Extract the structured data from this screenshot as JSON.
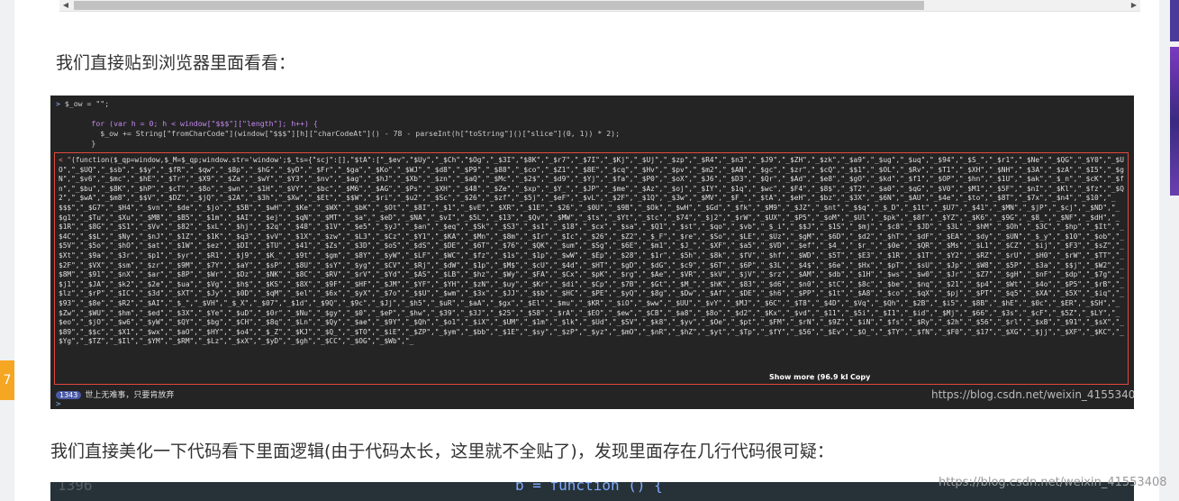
{
  "side": {
    "left_badge": "7"
  },
  "paragraphs": {
    "intro": "我们直接贴到浏览器里面看看：",
    "followup": "我们直接美化一下代码看下里面逻辑(由于代码太长，这里就不全贴了)，发现里面存在几行代码很可疑："
  },
  "console": {
    "line1_prompt": ">",
    "line1_code": " $_ow = \"\";",
    "line2": "        for (var h = 0; h < window[\"$$$\"][\"length\"]; h++) {",
    "line3": "          $_ow += String[\"fromCharCode\"](window[\"$$$\"][h][\"charCodeAt\"]() - 78 - parseInt(h[\"toString\"]()[\"slice\"](0, 1)) * 2);",
    "line4": "        }",
    "output_prefix": "< \"",
    "output_text": "(function($_qp=window,$_M=$_qp;window.str='window';$_ts={\"scj\":[],\"$tA\":[\"_$ev\",\"$Uy\",\"_$Ch\",\"$Og\",\"_$3I\",\"$8K\",\"_$r7\",\"_$7I\",\"_$Kj\",\"_$Uj\",\"_$zp\",\"_$R4\",\"_$n3\",\"_$J9\",\"_$ZH\",\"_$zk\",\"_$a9\",\"_$ug\",\"_$uq\",\"_$94\",\"_$S_\",\"_$r1\",\"_$Ne\",\"_$QG\",\"_$Y0\",\"_$UO\",\"_$UQ\",\"_$sb\",\"_$$y\",\"_$fR\",\"_$qw\",\"_$8p\",\"_$hG\",\"_$yD\",\"_$Fr\",\"_$ga\",\"_$Ko\",\"_$WJ\",\"_$d8\",\"_$P9\",\"_$88\",\"_$co\",\"_$Z1\",\"_$8E\",\"_$cq\",\"_$Hv\",\"_$pv\",\"_$m2\",\"_$AN\",\"_$gc\",\"_$zr\",\"_$cQ\",\"_$$1\",\"_$OL\",\"_$Rv\",\"_$T1\",\"_$XH\",\"_$NH\",\"_$3A\",\"_$zA\",\"_$I5\",\"_$gN\",\"_$v6\",\"_$mc\",\"_$hE\",\"_$Tr\",\"_$X9\",\"_$Za\",\"_$wY\",\"_$Y3\",\"_$nv\",\"_$ag\",\"_$hJ\",\"_$Xb\",\"_$zn\",\"_$aQ\",\"_$Mc\",\"_$2$\",\"_$d9\",\"_$Yj\",\"_$fa\",\"_$P0\",\"_$oX\",\"_$J6\",\"_$D3\",\"_$Qr\",\"_$Ad\",\"_$e8\",\"_$gO\",\"_$kd\",\"_$f1\",\"_$OP\",\"_$hn\",\"_$1U\",\"_$ak\",\"_$_n\",\"_$cK\",\"_$fn\",\"_$bu\",\"_$8K\",\"_$hP\",\"_$cT\",\"_$8o\",\"_$wn\",\"_$1H\",\"_$VY\",\"_$bc\",\"_$M6\",\"_$AG\",\"_$Ps\",\"_$XH\",\"_$48\",\"_$Ze\",\"_$xp\",\"_$Y_\",\"_$JP\",\"_$me\",\"_$Az\",\"_$oj\",\"_$IY\",\"_$1q\",\"_$wc\",\"_$F4\",\"_$8$\",\"_$T2\",\"_$a0\",\"_$qG\",\"_$V0\",\"_$M1\",\"_$5F\",\"_$nI\",\"_$Kl\",\"_$fz\",\"_$Q2\",\"_$wA\",\"_$m8\",\"_$$V\",\"_$DZ\",\"_$jQ\",\"_$2A\",\"_$3h\",\"_$Xw\",\"_$Et\",\"_$$W\",\"_$ri\",\"_$u2\",\"_$Sc\",\"_$26\",\"_$zf\",\"_$5j\",\"_$eF\",\"_$vL\",\"_$2F\",\"_$1Q\",\"_$3w\",\"_$MV\",\"_$F_\",\"_$tA\",\"_$eH\",\"_$bz\",\"_$3X\",\"_$6N\",\"_$AU\",\"_$4e\",\"_$to\",\"_$8T\",\"_$7x\",\"_$n4\",\"_$10\",\"_$$$\",\"_$G7\",\"_$H4\",\"_$vn\",\"_$de\",\"_$jo\",\"_$5B\",\"_$wH\",\"_$Ke\",\"_$WX\",\"_$bK\",\"_$Ot\",\"_$8I\",\"_$1\",\"_$vE\",\"_$XR\",\"_$1E\",\"_$26\",\"_$0U\",\"_$9B\",\"_$Ok\",\"_$wH\",\"_$Gd\",\"_$fk\",\"_$M9\",\"_$JZ\",\"_$nt\",\"_$$q\",\"_$_D\",\"_$1t\",\"_$U7\",\"_$41\",\"_$MN\",\"_$jP\",\"_$cj\",\"_$ND\",\"_$g1\",\"_$Tu\",\"_$Xu\",\"_$MB\",\"_$B5\",\"_$1m\",\"_$AI\",\"_$ej\",\"_$qN\",\"_$MT\",\"_$a\",\"_$eD\",\"_$NA\",\"_$vI\",\"_$5L\",\"_$13\",\"_$Qv\",\"_$MW\",\"_$ts\",\"_$Yt\",\"_$tc\",\"_$74\",\"_$j2\",\"_$rW\",\"_$UX\",\"_$P5\",\"_$oM\",\"_$Ul\",\"_$pk\",\"_$8f\",\"_$YZ\",\"_$K6\",\"_$9G\",\"_$8_\",\"_$NF\",\"_$dH\",\"_$1R\",\"_$8G\",\"_$S1\",\"_$Vv\",\"_$82\",\"_$xL\",\"_$hj\",\"_$2q\",\"_$48\",\"_$1V\",\"_$e5\",\"_$yJ\",\"_$an\",\"_$eq\",\"_$Sk\",\"_$S3\",\"_$s1\",\"_$18\",\"_$cx\",\"_$sa\",\"_$Q1\",\"_$st\",\"_$qo\",\"_$vb\",\"_$_i\",\"_$$J\",\"_$1S\",\"_$mj\",\"_$c8\",\"_$JD\",\"_$3L\",\"_$hM\",\"_$Oh\",\"_$3C\",\"_$hp\",\"_$It\",\"_$4C\",\"_$$L\",\"_$Ny\",\"_$nJ\",\"_$1Z\",\"_$1K\",\"_$q3\",\"_$vV\",\"_$1X\",\"_$zw\",\"_$L3\",\"_$Cz\",\"_$Y1\",\"_$KA\",\"_$Mn\",\"_$8m\",\"_$Ir\",\"_$Ic\",\"_$26\",\"_$Z2\",\"_$_F\",\"_$re\",\"_$So\",\"_$LE\",\"_$Uz\",\"_$gM\",\"_$6D\",\"_$d2\",\"_$hT\",\"_$dF\",\"_$EA\",\"_$dy\",\"_$UN\",\"_$_y\",\"_$10\",\"_$ob\",\"_$5V\",\"_$5o\",\"_$hO\",\"_$at\",\"_$1W\",\"_$ez\",\"_$DI\",\"_$TU\",\"_$41\",\"_$Zs\",\"_$3D\",\"_$oS\",\"_$dS\",\"_$DE\",\"_$6T\",\"_$76\",\"_$QK\",\"_$um\",\"_$Sg\",\"_$6E\",\"_$m1\",\"_$J_\",\"_$XF\",\"_$a5\",\"_$VD\",\"_$ef\",\"_$4_\",\"_$r_\",\"_$0e\",\"_$QR\",\"_$Ms\",\"_$L1\",\"_$CZ\",\"_$ij\",\"_$F3\",\"_$sZ\",\"_$Xt\",\"_$9a\",\"_$3r\",\"_$p1\",\"_$yr\",\"_$R1\",\"_$j9\",\"_$K_\",\"_$9t\",\"_$gm\",\"_$8Y\",\"_$yW\",\"_$LF\",\"_$WC\",\"_$fz\",\"_$1s\",\"_$1p\",\"_$wW\",\"_$Ep\",\"_$28\",\"_$1r\",\"_$5h\",\"_$8k\",\"_$fV\",\"_$hf\",\"_$WD\",\"_$5T\",\"_$E3\",\"_$1R\",\"_$1T\",\"_$Y2\",\"_$RZ\",\"_$rU\",\"_$H0\",\"_$rW\",\"_$TT\",\"_$2F\",\"_$VX\",\"_$sm\",\"_$zr\",\"_$9M\",\"_$7Y\",\"_$aY\",\"_$sP\",\"_$8U\",\"_$sY\",\"_$yg\",\"_$CV\",\"_$Rj\",\"_$dW\",\"_$1p\",\"_$M$\",\"_$cU\",\"_$4d\",\"_$HT\",\"_$gD\",\"_$dG\",\"_$c9\",\"_$6T\",\"_$6P\",\"_$3L\",\"_$4$\",\"_$6e\",\"_$Hx\",\"_$pT\",\"_$sU\",\"_$Jp\",\"_$W8\",\"_$5P\",\"_$3a\",\"_$$j\",\"_$W2\",\"_$8M\",\"_$91\",\"_$nX\",\"_$ar\",\"_$8P\",\"_$Wr\",\"_$Dz\",\"_$NK\",\"_$8C\",\"_$RV\",\"_$rV\",\"_$Yd\",\"_$AS\",\"_$LB\",\"_$hz\",\"_$Wy\",\"_$FA\",\"_$Cx\",\"_$pK\",\"_$rg\",\"_$Ae\",\"_$VR\",\"_$kV\",\"_$jV\",\"_$rz\",\"_$AM\",\"_$db\",\"_$1H\",\"_$ws\",\"_$w0\",\"_$Jr\",\"_$Z7\",\"_$gH\",\"_$nF\",\"_$dp\",\"_$7g\",\"_$j1\",\"_$JA\",\"_$k2\",\"_$2e\",\"_$ua\",\"_$Vg\",\"_$h$\",\"_$KS\",\"_$8X\",\"_$9F\",\"_$HF\",\"_$JM\",\"_$YF\",\"_$YH\",\"_$zN\",\"_$uy\",\"_$Kr\",\"_$di\",\"_$Cp\",\"_$7B\",\"_$Gt\",\"_$M_\",\"_$hK\",\"_$83\",\"_$d6\",\"_$n0\",\"_$tC\",\"_$8c\",\"_$be\",\"_$nq\",\"_$21\",\"_$p4\",\"_$Wt\",\"_$4o\",\"_$P5\",\"_$rB\",\"_$lz\",\"_$rP\",\"_$IC\",\"_$3d\",\"_$XT\",\"_$Jy\",\"_$0D\",\"_$qM\",\"_$el\",\"_$6x\",\"_$yX\",\"_$7o\",\"_$$U\",\"_$wm\",\"_$3x\",\"_$JJ\",\"_$$b\",\"_$HC\",\"_$PE\",\"_$yQ\",\"_$8g\",\"_$Dw\",\"_$Af\",\"_$DE\",\"_$h6\",\"_$PP\",\"_$1t\",\"_$A8\",\"_$co\",\"_$qX\",\"_$pj\",\"_$PT\",\"_$q5\",\"_$XA\",\"_$5X\",\"_$iq\",\"_$93\",\"_$8e\",\"_$R2\",\"_$AI\",\"_$_\",\"_$VH\",\"_$_X\",\"_$07\",\"_$1d\",\"_$9Q\",\"_$9c\",\"_$Jj\",\"_$h5\",\"_$uR\",\"_$aA\",\"_$gx\",\"_$El\",\"_$mu\",\"_$KR\",\"_$iO\",\"_$ww\",\"_$UU\",\"_$vY\",\"_$MJ\",\"_$6C\",\"_$T8\",\"_$4D\",\"_$Vq\",\"_$Qh\",\"_$2B\",\"_$i5\",\"_$8B\",\"_$hE\",\"_$0c\",\"_$ER\",\"_$SH\",\"_$Zw\",\"_$WU\",\"_$hm\",\"_$ed\",\"_$3X\",\"_$Ye\",\"_$uD\",\"_$0r\",\"_$Nu\",\"_$gy\",\"_$0\",\"_$eP\",\"_$hw\",\"_$39\",\"_$3J\",\"_$25\",\"_$58\",\"_$rA\",\"_$EO\",\"_$ew\",\"_$CB\",\"_$a8\",\"_$8o\",\"_$d2\",\"_$Kx\",\"_$vd\",\"_$11\",\"_$5i\",\"_$I1\",\"_$id\",\"_$Mj\",\"_$66\",\"_$3s\",\"_$cF\",\"_$5Z\",\"_$LY\",\"_$eo\",\"_$jO\",\"_$w6\",\"_$yW\",\"_$QY\",\"_$bg\",\"_$CH\",\"_$8q\",\"_$Ln\",\"_$Qy\",\"_$ae\",\"_$9Y\",\"_$Qh\",\"_$o1\",\"_$iX\",\"_$UM\",\"_$1m\",\"_$lk\",\"_$Ud\",\"_$SV\",\"_$k8\",\"_$yv\",\"_$Oe\",\"_$pt\",\"_$FM\",\"_$rN\",\"_$9Z\",\"_$iN\",\"_$fs\",\"_$Ry\",\"_$2h\",\"_$56\",\"_$rl\",\"_$xB\",\"_$91\",\"_$sX\",\"_$89\",\"_$$c\",\"_$X1\",\"_$wx\",\"_$aO\",\"_$HY\",\"_$o4\",\"_$_Z\",\"_$KJ\",\"_$Q_\",\"_$TO\",\"_$iE\",\"_$ZP\",\"_$ym\",\"_$bb\",\"_$1E\",\"_$sy\",\"_$zP\",\"_$yz\",\"_$mO\",\"_$nR\",\"_$hZ\",\"_$yt\",\"_$Tp\",\"_$fY\",\"_$56\",\"_$Ev\",\"_$O_\",\"_$TY\",\"_$fN\",\"_$F0\",\"_$17\",\"_$XG\",\"_$jj\",\"_$XF\",\"_$KC\",\"_$Yg\",\"_$TZ\",\"_$Il\",\"_$YM\",\"_$RM\",\"_$Lz\",\"_$xX\",\"_$yD\",\"_$gh\",\"_$CC\",\"_$OG\",\"_$Wb\",\"_",
    "show_more": "Show more (96.9 kB)",
    "copy": "Copy",
    "status_count": "1343",
    "status_text": "世上无难事，只要肯放弃",
    "watermark": "https://blog.csdn.net/weixin_41553408",
    "bottom_prompt": ">"
  },
  "editor": {
    "line_number": "1396",
    "code": "b = function () {"
  },
  "watermark_bottom": "https://blog.csdn.net/weixin_41553408"
}
